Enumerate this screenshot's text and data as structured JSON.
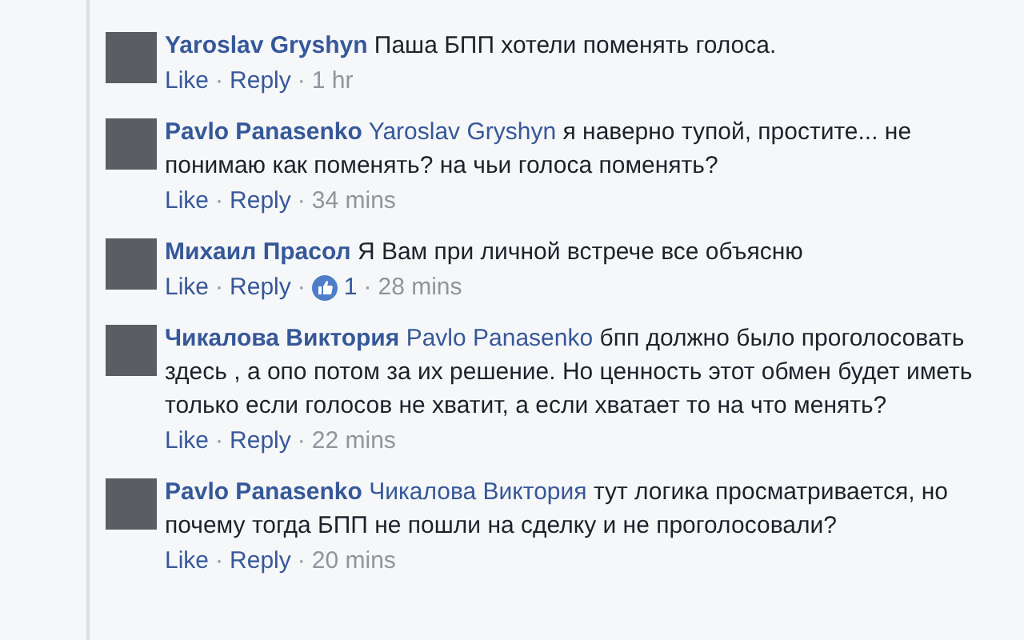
{
  "comments": [
    {
      "author": "Yaroslav Gryshyn",
      "text": "Паша БПП хотели поменять голоса.",
      "like": "Like",
      "separator": "·",
      "reply": "Reply",
      "time": "1 hr"
    },
    {
      "author": "Pavlo Panasenko",
      "mention": "Yaroslav Gryshyn",
      "text": "я наверно тупой, простите... не понимаю как поменять? на чьи голоса поменять?",
      "like": "Like",
      "separator": "·",
      "reply": "Reply",
      "time": "34 mins"
    },
    {
      "author": "Михаил Прасол",
      "text": "Я Вам при личной встрече все объясню",
      "like": "Like",
      "separator": "·",
      "reply": "Reply",
      "likes": "1",
      "time": "28 mins"
    },
    {
      "author": "Чикалова Виктория",
      "mention": "Pavlo Panasenko",
      "text": "бпп должно было проголосовать здесь , а опо потом за их решение. Но ценность этот обмен будет иметь только если голосов не хватит, а если хватает то на что менять?",
      "like": "Like",
      "separator": "·",
      "reply": "Reply",
      "time": "22 mins"
    },
    {
      "author": "Pavlo Panasenko",
      "mention": "Чикалова Виктория",
      "text": "тут логика просматривается, но почему тогда БПП не пошли на сделку и не проголосовали?",
      "like": "Like",
      "separator": "·",
      "reply": "Reply",
      "time": "20 mins"
    }
  ]
}
